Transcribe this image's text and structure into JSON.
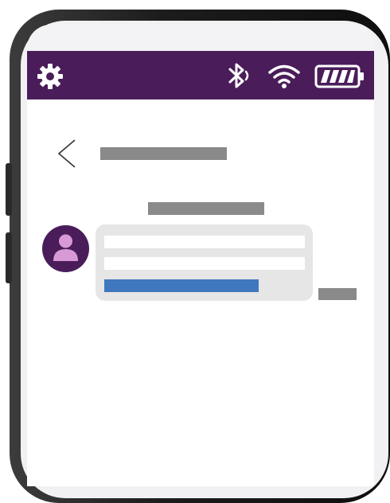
{
  "status_bar": {
    "color": "#4a1d5a",
    "icons": [
      "gear-icon",
      "bluetooth-icon",
      "wifi-icon",
      "battery-icon"
    ]
  },
  "header": {
    "back_icon": "chevron-left-icon",
    "title": ""
  },
  "chat": {
    "date_label": "",
    "messages": [
      {
        "avatar_icon": "person-icon",
        "lines": [
          "",
          ""
        ],
        "link": "",
        "timestamp": ""
      }
    ],
    "link_color": "#3f78be"
  }
}
